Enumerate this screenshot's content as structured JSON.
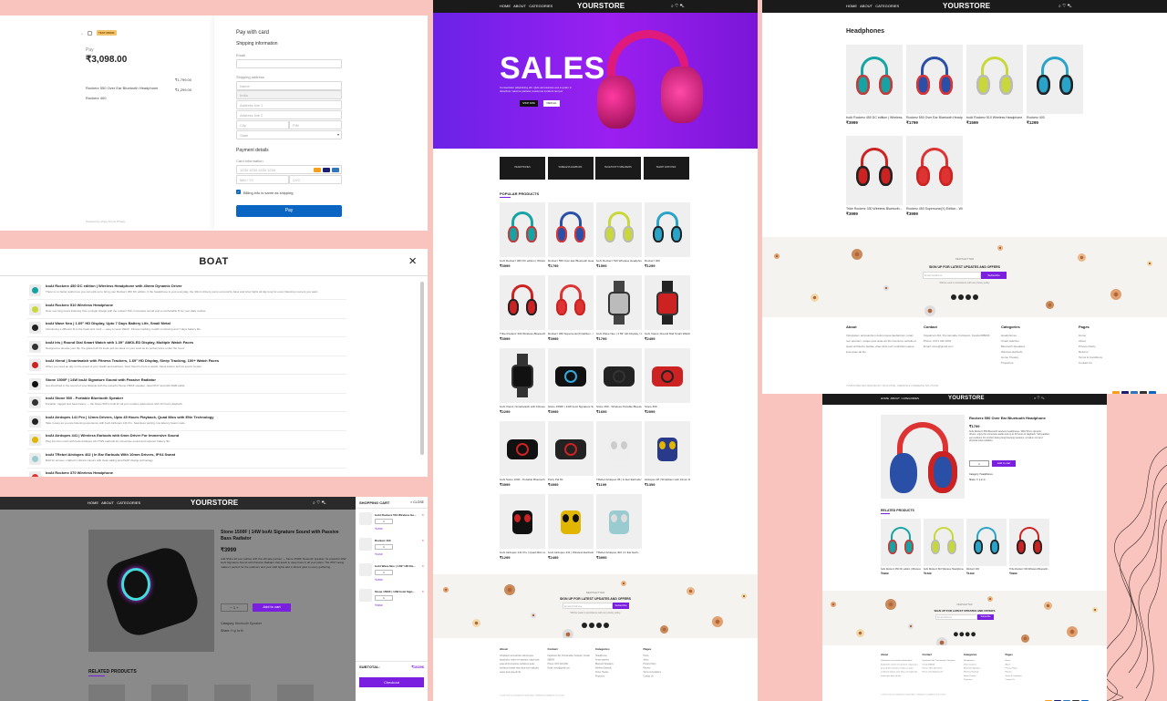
{
  "checkout": {
    "test_badge": "TEST MODE",
    "pay_label": "Pay",
    "amount": "₹3,098.00",
    "items": [
      {
        "name": "Rockerz 550 Over Ear Bluetooth Headphone",
        "price": "₹1,799.00"
      },
      {
        "name": "Rockerz 400",
        "price": "₹1,299.00"
      }
    ],
    "footer": "Powered by stripe   Terms  Privacy",
    "title": "Pay with card",
    "shipping_heading": "Shipping information",
    "email_label": "Email",
    "shipping_address_label": "Shipping address",
    "name_ph": "Name",
    "country": "India",
    "addr1_ph": "Address line 1",
    "addr2_ph": "Address line 2",
    "city_ph": "City",
    "pin_ph": "PIN",
    "state_ph": "State",
    "payment_heading": "Payment details",
    "card_label": "Card information",
    "card_ph": "1234 1234 1234 1234",
    "exp_ph": "MM / YY",
    "cvc_ph": "CVC",
    "billing_same": "Billing info is same as shipping",
    "pay_button": "Pay"
  },
  "boat": {
    "title": "BOAT",
    "close_icon": "×",
    "items": [
      {
        "title": "boAt Rockerz 450 DC edition | Wireless Headphone with 40mm Dynamic Driver",
        "desc": "There is no better audio love you can pick up to bring your Rockerz 450 DC edition. If the headphone is your everyday, the 40mm drivers pump out punchy bass and crisp highs all day long for every listening moment you want.",
        "color": "#16a3a3"
      },
      {
        "title": "boAt Rockerz 510 Wireless Headphone",
        "desc": "Now, use long hours listening from a single charge with the rockerz 510. Immersive sound and a comfortable fit for your daily routine.",
        "color": "#c8d83a"
      },
      {
        "title": "boAt Wave Neo | 1.69\" HD Display, Upto 7 Days Battery Life, Small Metal",
        "desc": "Introducing a different fit to the heart and mind — easy to wear Watch. Fitness tracking, health monitoring and 7 days battery life.",
        "color": "#222"
      },
      {
        "title": "boAt Iris | Round Dial Smart Watch with 1.39\" AMOLED Display, Multiple Watch Faces",
        "desc": "Designed to elevate your life, the glass-bell Iris looks just as sleek on your wrist as its performance under the hood.",
        "color": "#333"
      },
      {
        "title": "boAt Xtend | Smartwatch with Fitness Trackers, 1.69\" HD Display, Sleep Tracking, 100+ Watch Faces",
        "desc": "When you need an ally on the quest of your health and wellness, boAt Xtend is here to assist. Alexa built-in and 14 sports modes.",
        "color": "#c22"
      },
      {
        "title": "Stone 1500F | 14W boAt Signature Sound with Passive Radiator",
        "desc": "Get drenched in the sound of your lifestyle with the powerful Stone 1500F speaker, rated IPX7 and with RGB LEDs.",
        "color": "#111"
      },
      {
        "title": "boAt Stone 500 - Portable Bluetooth Speaker",
        "desc": "Portable, rugged and bass-heavy — the Stone 500 is built for all your outdoor adventures with 10 hours playback.",
        "color": "#333"
      },
      {
        "title": "boAt Airdopes 141 Pro | 12mm Drivers, Upto 45 Hours Playback, Quad Mics with ENx Technology",
        "desc": "Take it easy as you are listening experience with boAt Airdopes 141 Pro. Seamless pairing, low latency beast mode.",
        "color": "#222"
      },
      {
        "title": "boAt Airdopes 441 | Wireless Earbuds with 6mm Driver For Immersive Sound",
        "desc": "Plug into the music with boAt Airdopes 441 TWS earbuds for immersive sound and superior battery life.",
        "color": "#e0b600"
      },
      {
        "title": "boAt TRebel Airdopes 402 | In Ear Earbuds With 10mm Drivers, IPX4 Sweat",
        "desc": "Built for women, crafted in vibrant colours with clear calling and ASAP charge technology.",
        "color": "#9acbd0"
      },
      {
        "title": "boAt Rockerz 370 Wireless Headphone",
        "desc": "",
        "color": "#d33"
      }
    ]
  },
  "product_panel": {
    "nav": [
      "HOME",
      "ABOUT",
      "CATEGORIES"
    ],
    "logo": "YOURSTORE",
    "title": "Stone 1500F | 14W boAt Signature Sound with Passive Bass Radiator",
    "price": "₹3999",
    "desc": "Add Shine all your parties with the ultimate partner — Stone 1500F bluetooth speaker. Its powerful 14W boAt Signature Sound with Passive Radiator that leads to deep bass in all your plans. The IPX7 rating makes it perfect for the outdoors and your LED lights add a vibrant glow to every gathering.",
    "qty": "1",
    "add_to_cart": "Add to cart",
    "category_label": "Category:",
    "category": "Bluetooth Speaker",
    "share": "Share:",
    "related": "RELATED PRODUCTS",
    "cart_title": "SHOPPING CART",
    "cart_close": "CLOSE",
    "cart_items": [
      {
        "name": "boAt Rockerz 510 Wireless He...",
        "price": "₹1599",
        "qty": "1"
      },
      {
        "name": "Rockerz 400",
        "price": "₹1299",
        "qty": "1"
      },
      {
        "name": "boAt Wave Neo | 1.69\" HD Dis...",
        "price": "₹1899",
        "qty": "1"
      },
      {
        "name": "Stone 1500F | 14W boAt Sign...",
        "price": "₹3999",
        "qty": "1"
      }
    ],
    "subtotal_label": "SUBTOTAL:",
    "subtotal": "₹10296",
    "checkout": "Checkout"
  },
  "store": {
    "nav": [
      "HOME",
      "ABOUT",
      "CATEGORIES"
    ],
    "logo": "YOURSTORE",
    "hero_title": "SALES",
    "hero_sub": "Consectetur adipisicing elit. Quis accusamus eos a quam a doloribus maxime pariatur possimus incidunt tempor",
    "hero_btn1": "SHOP NOW",
    "hero_btn2": "VIEW ALL",
    "categories": [
      "HEADPHONES",
      "WIRELESS EARBUDS",
      "BLUETOOTH SPEAKERS",
      "SMART WATCHES"
    ],
    "popular_title": "POPULAR PRODUCTS",
    "products": [
      {
        "name": "boAt Rockerz 450 DC edition | Wireless...",
        "price": "₹3999",
        "kind": "hp",
        "c1": "#16a3a3",
        "c2": "#c73a3a"
      },
      {
        "name": "Rockerz 550 Over Ear Bluetooth Headph...",
        "price": "₹1799",
        "kind": "hp",
        "c1": "#2a4fa6",
        "c2": "#d33"
      },
      {
        "name": "boAt Rockerz 510 Wireless Headphone",
        "price": "₹1599",
        "kind": "hp",
        "c1": "#c8d83a",
        "c2": "#bbb"
      },
      {
        "name": "Rockerz 400",
        "price": "₹1299",
        "kind": "hp",
        "c1": "#2aa3c8",
        "c2": "#222"
      },
      {
        "name": "Tribe Rockerz 330 Wireless Bluetooth...",
        "price": "₹3999",
        "kind": "hp",
        "c1": "#c22",
        "c2": "#222"
      },
      {
        "name": "Rockerz 450 Supersonic(X) Edition - Wir...",
        "price": "₹3999",
        "kind": "hp",
        "c1": "#d33",
        "c2": "#c22"
      },
      {
        "name": "boAt Wave Neo | 1.69\" HD Display, Upto...",
        "price": "₹1799",
        "kind": "watch",
        "c1": "#bbb",
        "c2": "#444"
      },
      {
        "name": "boAt Xtend | Round Dial Smart Watch with...",
        "price": "₹2499",
        "kind": "watch",
        "c1": "#c22",
        "c2": "#222"
      },
      {
        "name": "boAt Xtend | Smartwatch with Fitness Tr...",
        "price": "₹2299",
        "kind": "watch",
        "c1": "#111",
        "c2": "#333"
      },
      {
        "name": "Stone 1500F | 14W boAt Signature Sound...",
        "price": "₹3999",
        "kind": "speaker",
        "c1": "#111",
        "c2": "#3ad"
      },
      {
        "name": "Stone 350 - Wireless Portable Bluetooth...",
        "price": "₹1699",
        "kind": "speaker",
        "c1": "#222",
        "c2": "#333"
      },
      {
        "name": "Stone 650",
        "price": "₹2999",
        "kind": "speaker",
        "c1": "#c22",
        "c2": "#222"
      },
      {
        "name": "boAt Stone 1000 - Portable Bluetooth Sp...",
        "price": "₹3999",
        "kind": "speaker",
        "c1": "#111",
        "c2": "#c22"
      },
      {
        "name": "Party Pal 60",
        "price": "₹4999",
        "kind": "speaker",
        "c1": "#222",
        "c2": "#c22"
      },
      {
        "name": "TRebel Airdopes 38 | In Ear Earbuds With...",
        "price": "₹1199",
        "kind": "buds",
        "c1": "#eee",
        "c2": "#ccc"
      },
      {
        "name": "Airdopes 38 | 50 Edition with 10mm Dri...",
        "price": "₹1399",
        "kind": "buds",
        "c1": "#2a3a8a",
        "c2": "#e0b600"
      },
      {
        "name": "boAt Airdopes 141 Pro | Quad Mics with...",
        "price": "₹1299",
        "kind": "buds",
        "c1": "#111",
        "c2": "#c22"
      },
      {
        "name": "boAt Airdopes 441 | Wireless Earbuds wit...",
        "price": "₹2499",
        "kind": "buds",
        "c1": "#e0b600",
        "c2": "#111"
      },
      {
        "name": "TRebel Airdopes 402 | In Ear Earb...",
        "price": "₹3999",
        "kind": "buds",
        "c1": "#9acbd0",
        "c2": "#ddd"
      }
    ],
    "newsletter": "NEWSLETTER",
    "newsletter_title": "SIGN UP FOR LATEST UPDATES AND OFFERS",
    "email_ph": "Email Address",
    "subscribe": "Subscribe",
    "newsletter_note": "Will be used in accordance with our privacy policy",
    "footer": {
      "about_h": "About",
      "about": "Voluptatem accusantium doloremque laudantium, totam rem aperiam, eaque ipsa quae ab illo inventore veritatis et quasi architecto beatae vitae dicta sunt explicabo eaque ipsa quae ab illo.",
      "contact_h": "Contact",
      "contact": [
        "Kayaloram Rd, Punnamada, Kottayam, Kerala 688006",
        "Phone: 0471 440 2201",
        "Email: store@gmail.com"
      ],
      "categories_h": "Categories",
      "categories": [
        "Headphones",
        "Smart watches",
        "Bluetooth Speakers",
        "Wireless Earbuds",
        "Home Theatre",
        "Projectors"
      ],
      "pages_h": "Pages",
      "pages": [
        "Home",
        "About",
        "Privacy Policy",
        "Returns",
        "Terms & Conditions",
        "Contact Us"
      ],
      "copyright": "YOURSTORE 2022 CREATED BY VIKAS PATEL. PREMIUM E-COMMERCE SOLUTIONS."
    }
  },
  "cat": {
    "nav": [
      "HOME",
      "ABOUT",
      "CATEGORIES"
    ],
    "logo": "YOURSTORE",
    "title": "Headphones",
    "products": [
      {
        "name": "boAt Rockerz 450 DC edition | Wireless...",
        "price": "₹3999",
        "c1": "#16a3a3",
        "c2": "#c73a3a"
      },
      {
        "name": "Rockerz 550 Over Ear Bluetooth Headp...",
        "price": "₹1799",
        "c1": "#2a4fa6",
        "c2": "#d33"
      },
      {
        "name": "boAt Rockerz 510 Wireless Headphone",
        "price": "₹1599",
        "c1": "#c8d83a",
        "c2": "#bbb"
      },
      {
        "name": "Rockerz 400",
        "price": "₹1299",
        "c1": "#2aa3c8",
        "c2": "#222"
      },
      {
        "name": "Tribe Rockerz 330 Wireless Bluetooth...",
        "price": "₹3999",
        "c1": "#c22",
        "c2": "#222"
      },
      {
        "name": "Rockerz 450 Supersonic(X) Edition - Wi...",
        "price": "₹3999",
        "c1": "#d33",
        "c2": "#c22"
      }
    ]
  },
  "detail": {
    "logo": "YOURSTORE",
    "nav": [
      "HOME",
      "ABOUT",
      "CATEGORIES"
    ],
    "title": "Rockerz 550 Over Ear Bluetooth Headphone",
    "price": "₹1799",
    "desc": "boAt Rockerz 550 Bluetooth wireless headphones. With 50mm dynamic drivers, enjoy the immersive audio and up to 20 hours of playback. Soft padded ear cushions for comfort during long listening sessions, a built-in mic and physical noise isolation.",
    "qty": "1",
    "add": "Add to cart",
    "category": "Category: Headphones",
    "share": "Share:",
    "related": "RELATED PRODUCTS",
    "related_items": [
      {
        "name": "boAt Rockerz 450 DC edition | Wireless...",
        "price": "₹3999",
        "c1": "#16a3a3",
        "c2": "#c73a3a"
      },
      {
        "name": "boAt Rockerz 510 Wireless Headphone",
        "price": "₹1599",
        "c1": "#c8d83a",
        "c2": "#bbb"
      },
      {
        "name": "Rockerz 400",
        "price": "₹1299",
        "c1": "#2aa3c8",
        "c2": "#222"
      },
      {
        "name": "Tribe Rockerz 330 Wireless Bluetooth...",
        "price": "₹3999",
        "c1": "#c22",
        "c2": "#222"
      }
    ]
  }
}
